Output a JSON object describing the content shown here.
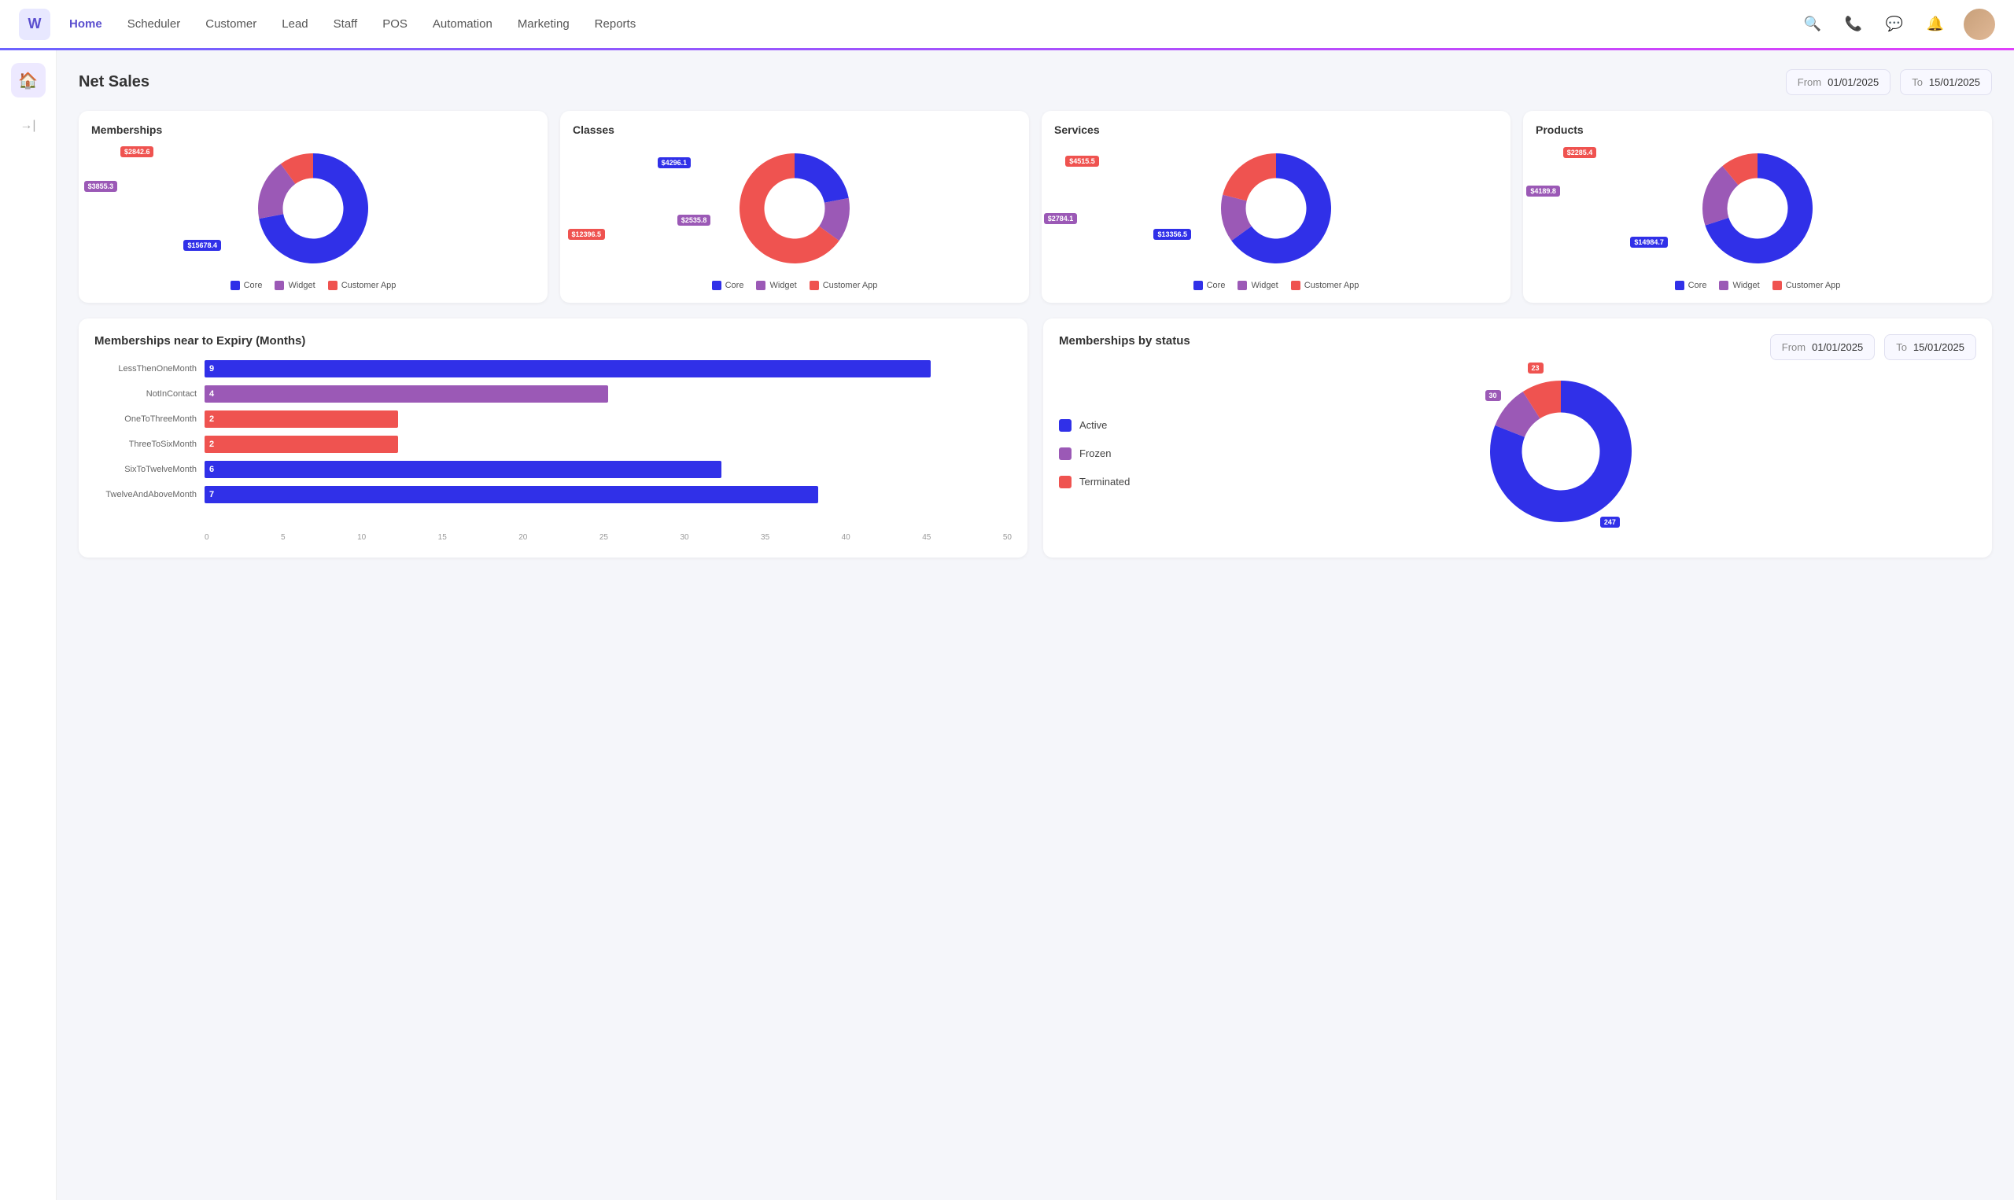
{
  "app": {
    "logo": "W",
    "nav": [
      {
        "label": "Home",
        "active": true
      },
      {
        "label": "Scheduler",
        "active": false
      },
      {
        "label": "Customer",
        "active": false
      },
      {
        "label": "Lead",
        "active": false
      },
      {
        "label": "Staff",
        "active": false
      },
      {
        "label": "POS",
        "active": false
      },
      {
        "label": "Automation",
        "active": false
      },
      {
        "label": "Marketing",
        "active": false
      },
      {
        "label": "Reports",
        "active": false
      }
    ]
  },
  "netSales": {
    "title": "Net Sales",
    "fromLabel": "From",
    "toLabel": "To",
    "fromDate": "01/01/2025",
    "toDate": "15/01/2025"
  },
  "charts": [
    {
      "title": "Memberships",
      "labels": [
        "Core",
        "Widget",
        "Customer App"
      ],
      "values": [
        15678.4,
        3855.3,
        2842.6
      ],
      "colors": [
        "#3030e8",
        "#9b59b6",
        "#ef5350"
      ],
      "segments": [
        72,
        18,
        10
      ]
    },
    {
      "title": "Classes",
      "labels": [
        "Core",
        "Widget",
        "Customer App"
      ],
      "values": [
        4296.1,
        2535.8,
        12396.5
      ],
      "colors": [
        "#3030e8",
        "#9b59b6",
        "#ef5350"
      ],
      "segments": [
        22,
        13,
        65
      ]
    },
    {
      "title": "Services",
      "labels": [
        "Core",
        "Widget",
        "Customer App"
      ],
      "values": [
        13356.5,
        2784.1,
        4515.5
      ],
      "colors": [
        "#3030e8",
        "#9b59b6",
        "#ef5350"
      ],
      "segments": [
        65,
        14,
        21
      ]
    },
    {
      "title": "Products",
      "labels": [
        "Core",
        "Widget",
        "Customer App"
      ],
      "values": [
        14984.7,
        4189.8,
        2285.4
      ],
      "colors": [
        "#3030e8",
        "#9b59b6",
        "#ef5350"
      ],
      "segments": [
        70,
        19,
        11
      ]
    }
  ],
  "expiryChart": {
    "title": "Memberships near to Expiry (Months)",
    "bars": [
      {
        "label": "LessThenOneMonth",
        "value": 9,
        "color": "#3030e8",
        "pct": 90
      },
      {
        "label": "NotInContact",
        "value": 4,
        "color": "#9b59b6",
        "pct": 50
      },
      {
        "label": "OneToThreeMonth",
        "value": 2,
        "color": "#ef5350",
        "pct": 24
      },
      {
        "label": "ThreeToSixMonth",
        "value": 2,
        "color": "#ef5350",
        "pct": 24
      },
      {
        "label": "SixToTwelveMonth",
        "value": 6,
        "color": "#3030e8",
        "pct": 64
      },
      {
        "label": "TwelveAndAboveMonth",
        "value": 7,
        "color": "#3030e8",
        "pct": 76
      }
    ],
    "axisLabels": [
      "0",
      "5",
      "10",
      "15",
      "20",
      "25",
      "30",
      "35",
      "40",
      "45",
      "50"
    ]
  },
  "statusChart": {
    "title": "Memberships by status",
    "fromLabel": "From",
    "toLabel": "To",
    "fromDate": "01/01/2025",
    "toDate": "15/01/2025",
    "legend": [
      {
        "label": "Active",
        "color": "#3030e8"
      },
      {
        "label": "Frozen",
        "color": "#9b59b6"
      },
      {
        "label": "Terminated",
        "color": "#ef5350"
      }
    ],
    "values": [
      {
        "label": "247",
        "color": "#3030e8",
        "pct": 81
      },
      {
        "label": "30",
        "color": "#9b59b6",
        "pct": 10
      },
      {
        "label": "23",
        "color": "#ef5350",
        "pct": 9
      }
    ]
  }
}
